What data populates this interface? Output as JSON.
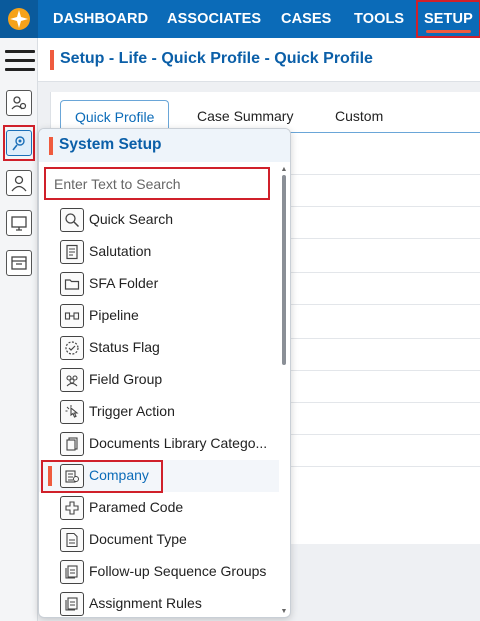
{
  "topnav": {
    "items": [
      "DASHBOARD",
      "ASSOCIATES",
      "CASES",
      "TOOLS"
    ],
    "active": "SETUP",
    "logo_icon": "star-logo-icon",
    "accent_color": "#0b6bb8"
  },
  "rail": {
    "icons": [
      "menu-icon",
      "profile-settings-icon",
      "system-setup-icon",
      "user-icon",
      "monitor-icon",
      "layout-icon"
    ]
  },
  "header": {
    "title": "Setup - Life - Quick Profile - Quick Profile"
  },
  "tabs": [
    "Quick Profile",
    "Case Summary",
    "Custom"
  ],
  "panel": {
    "title": "System Setup",
    "search_placeholder": "Enter Text to Search",
    "items": [
      {
        "label": "Quick Search",
        "icon": "magnifier-icon"
      },
      {
        "label": "Salutation",
        "icon": "document-icon"
      },
      {
        "label": "SFA Folder",
        "icon": "folder-icon"
      },
      {
        "label": "Pipeline",
        "icon": "pipeline-icon"
      },
      {
        "label": "Status Flag",
        "icon": "status-flag-icon"
      },
      {
        "label": "Field Group",
        "icon": "group-icon"
      },
      {
        "label": "Trigger Action",
        "icon": "pointer-click-icon"
      },
      {
        "label": "Documents Library Catego...",
        "icon": "documents-icon"
      },
      {
        "label": "Company",
        "icon": "company-icon",
        "selected": true
      },
      {
        "label": "Paramed Code",
        "icon": "medical-icon"
      },
      {
        "label": "Document Type",
        "icon": "document-type-icon"
      },
      {
        "label": "Follow-up Sequence Groups",
        "icon": "sequence-icon"
      },
      {
        "label": "Assignment Rules",
        "icon": "rules-icon"
      }
    ]
  },
  "colors": {
    "highlight_border": "#d0202a",
    "accent": "#ef5b3e",
    "link_blue": "#0b6bb8"
  }
}
